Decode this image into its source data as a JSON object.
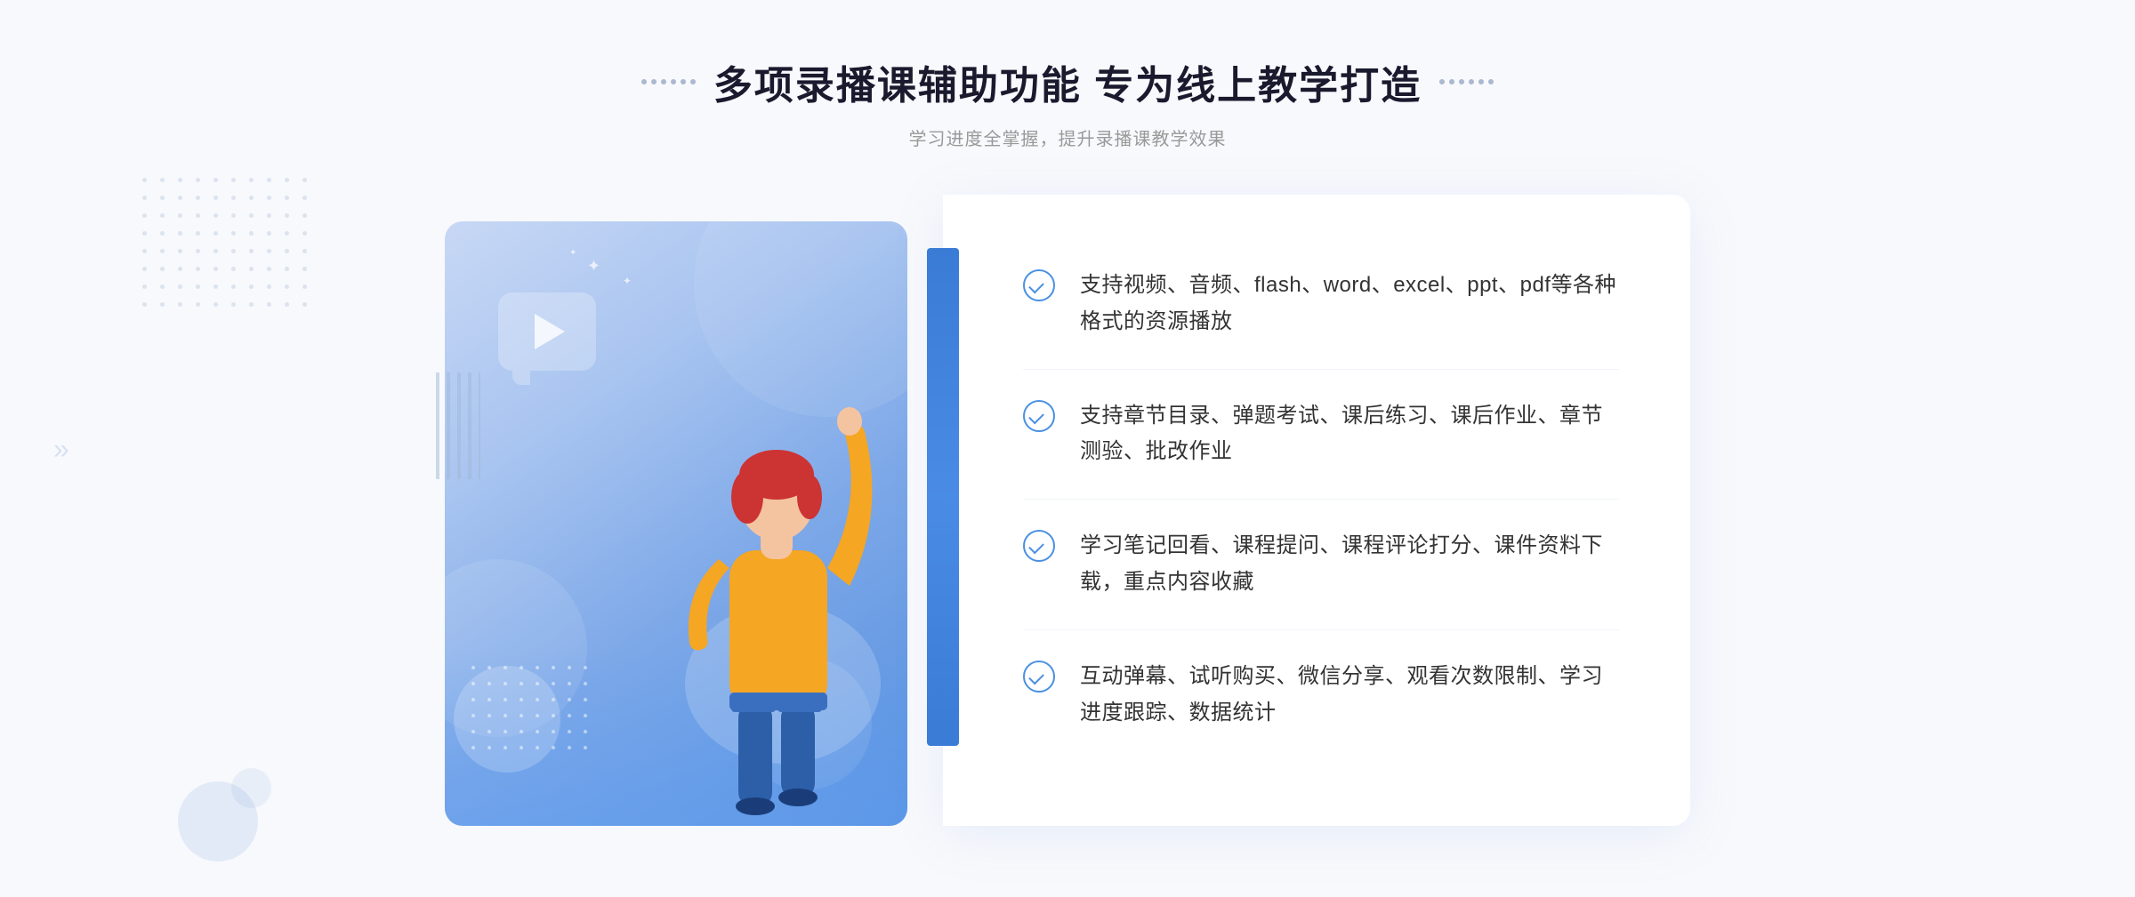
{
  "header": {
    "title": "多项录播课辅助功能 专为线上教学打造",
    "subtitle": "学习进度全掌握，提升录播课教学效果",
    "decorator_left": "❮❮",
    "decorator_right": "❯❯"
  },
  "features": [
    {
      "id": "feature-1",
      "text": "支持视频、音频、flash、word、excel、ppt、pdf等各种格式的资源播放"
    },
    {
      "id": "feature-2",
      "text": "支持章节目录、弹题考试、课后练习、课后作业、章节测验、批改作业"
    },
    {
      "id": "feature-3",
      "text": "学习笔记回看、课程提问、课程评论打分、课件资料下载，重点内容收藏"
    },
    {
      "id": "feature-4",
      "text": "互动弹幕、试听购买、微信分享、观看次数限制、学习进度跟踪、数据统计"
    }
  ],
  "colors": {
    "primary_blue": "#4a90e2",
    "dark_blue": "#3a7bd5",
    "light_blue_bg": "#f0f5fc",
    "title_color": "#1a1a2e",
    "text_color": "#333333",
    "subtitle_color": "#999999"
  }
}
